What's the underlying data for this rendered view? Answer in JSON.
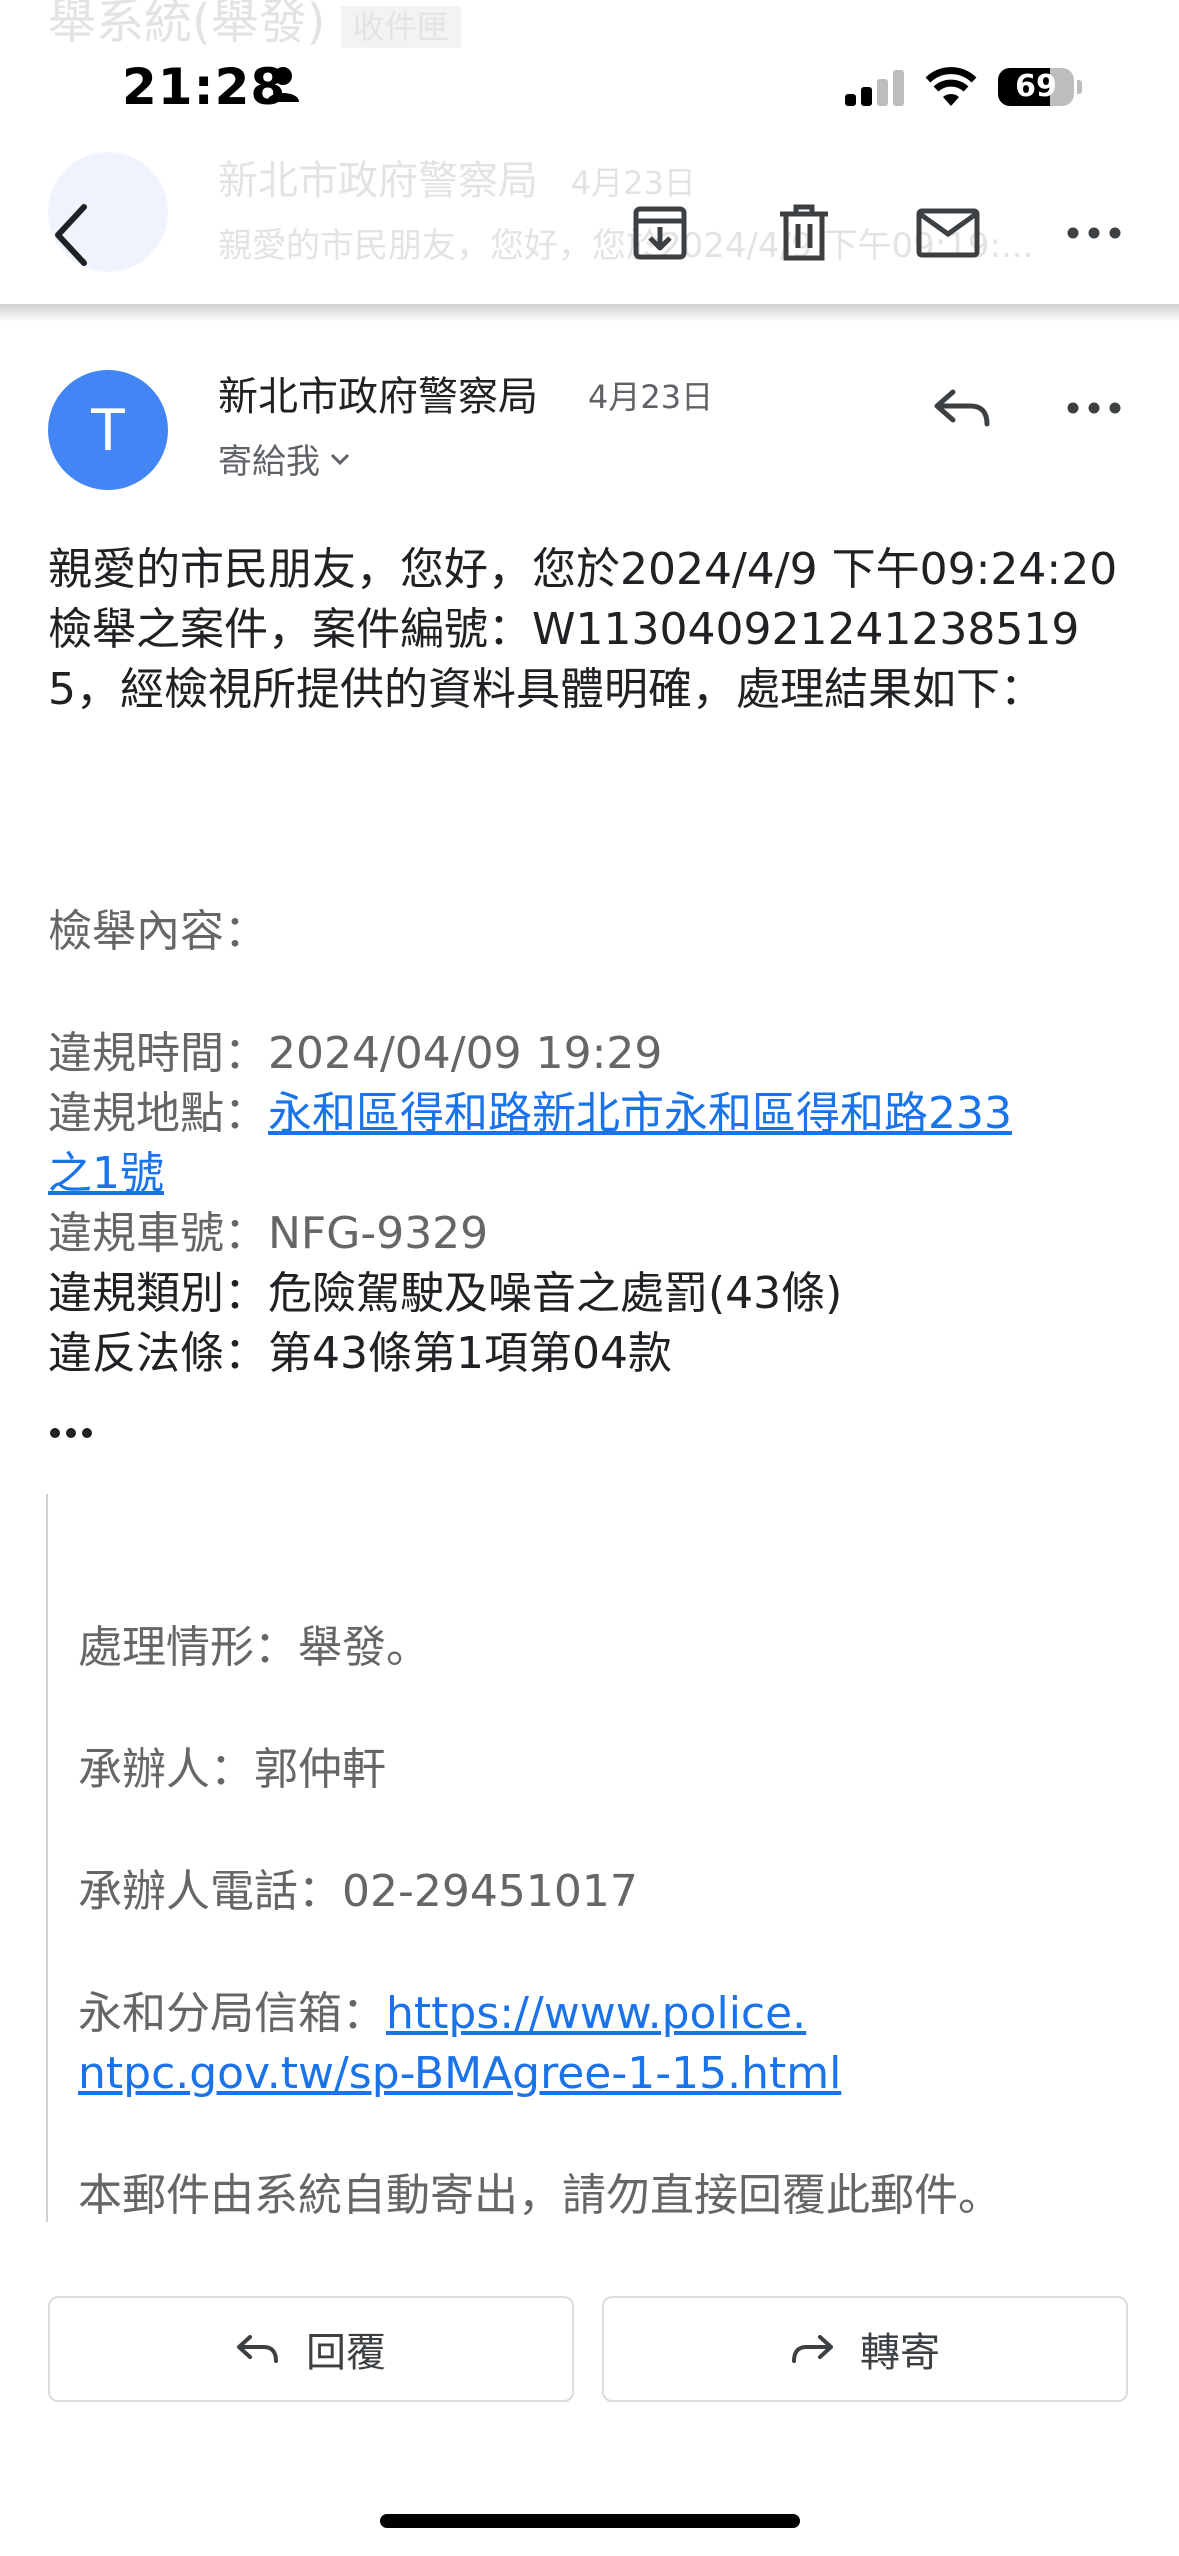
{
  "status_bar": {
    "time": "21:28",
    "battery": "69",
    "battery_level": 0.69
  },
  "background_preview": {
    "title": "舉系統(舉發)",
    "badge": "收件匣",
    "sender": "新北市政府警察局",
    "date": "4月23日",
    "snippet": "親愛的市民朋友，您好，您於2024/4/9 下午09:19:..."
  },
  "toolbar": {
    "back_icon": "chevron-left-icon",
    "archive_icon": "archive-icon",
    "delete_icon": "trash-icon",
    "mark_unread_icon": "mail-icon",
    "more_icon": "more-horizontal-icon"
  },
  "header": {
    "avatar_letter": "T",
    "avatar_color": "#4285f4",
    "sender": "新北市政府警察局",
    "date": "4月23日",
    "to_label": "寄給我"
  },
  "body": {
    "intro": "親愛的市民朋友，您好，您於2024/4/9 下午09:24:20檢舉之案件，案件編號：W1130409212412385195，經檢視所提供的資料具體明確，處理結果如下：",
    "section_label": "檢舉內容：",
    "violation_time_label": "違規時間：",
    "violation_time": "2024/04/09 19:29",
    "violation_place_label": "違規地點：",
    "violation_place_line1": "永和區得和路新北市永和區得和路233",
    "violation_place_line2": "之1號",
    "plate_label": "違規車號：",
    "plate": "NFG-9329",
    "category_label": "違規類別：",
    "category": "危險駕駛及噪音之處罰(43條)",
    "law_label": "違反法條：",
    "law": "第43條第1項第04款"
  },
  "quoted": {
    "status_label": "處理情形：",
    "status": "舉發。",
    "handler_label": "承辦人：",
    "handler": "郭仲軒",
    "phone_label": "承辦人電話：",
    "phone": "02-29451017",
    "mailbox_label": "永和分局信箱：",
    "mailbox_url_line1": "https://www.police.",
    "mailbox_url_line2": "ntpc.gov.tw/sp-BMAgree-1-15.html",
    "notice": "本郵件由系統自動寄出，請勿直接回覆此郵件。"
  },
  "actions": {
    "reply": "回覆",
    "forward": "轉寄"
  },
  "colors": {
    "link": "#1a73e8",
    "muted": "#666666",
    "accent": "#4285f4"
  }
}
